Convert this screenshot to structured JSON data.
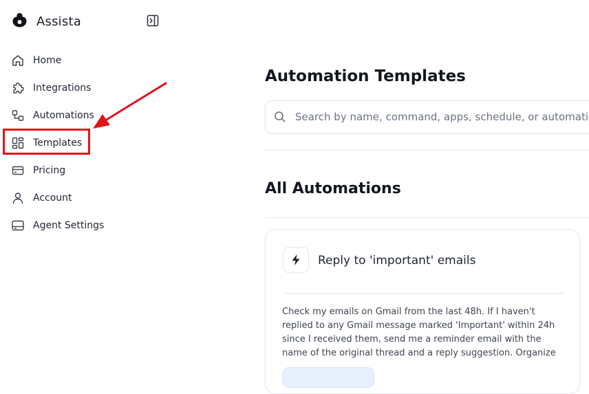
{
  "brand": {
    "name": "Assista"
  },
  "sidebar": {
    "items": [
      {
        "label": "Home",
        "icon": "home-icon"
      },
      {
        "label": "Integrations",
        "icon": "puzzle-icon"
      },
      {
        "label": "Automations",
        "icon": "workflow-icon"
      },
      {
        "label": "Templates",
        "icon": "templates-grid-icon"
      },
      {
        "label": "Pricing",
        "icon": "credit-card-icon"
      },
      {
        "label": "Account",
        "icon": "user-icon"
      },
      {
        "label": "Agent Settings",
        "icon": "agent-settings-icon"
      }
    ],
    "highlighted": "Templates"
  },
  "main": {
    "title": "Automation Templates",
    "search": {
      "placeholder": "Search by name, command, apps, schedule, or automation",
      "value": ""
    },
    "section_title": "All Automations",
    "cards": [
      {
        "title": "Reply to 'important' emails",
        "icon": "lightning-bolt-icon",
        "description": "Check my emails on Gmail from the last 48h. If I haven't replied to any Gmail message marked 'Important' within 24h since I received them, send me a reminder email with the name of the original thread and a reply suggestion. Organize the emails in a"
      }
    ]
  },
  "colors": {
    "annotation": "#e0121b",
    "text": "#1f2430",
    "muted": "#6b7280",
    "chip": "#e7f0fd"
  }
}
